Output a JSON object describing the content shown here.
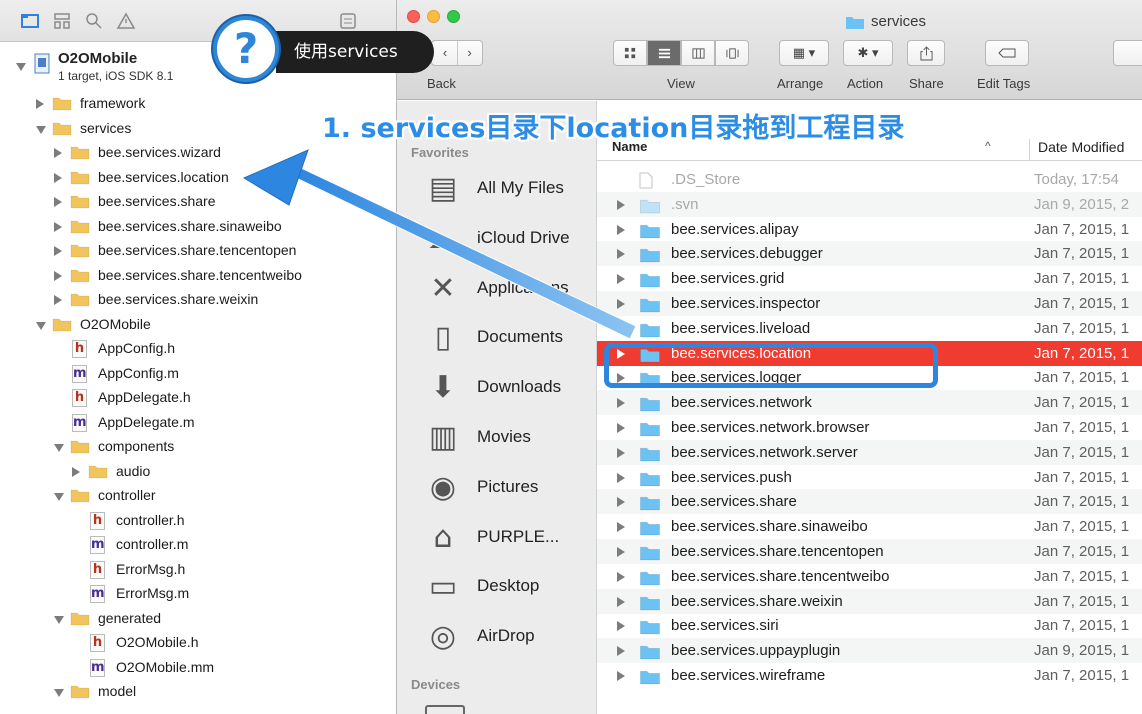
{
  "xcode": {
    "project": {
      "name": "O2OMobile",
      "subtitle": "1 target, iOS SDK 8.1"
    },
    "tree": [
      {
        "label": "framework",
        "kind": "folder",
        "indent": 1,
        "expanded": false,
        "disclosure": true
      },
      {
        "label": "services",
        "kind": "folder",
        "indent": 1,
        "expanded": true,
        "disclosure": true
      },
      {
        "label": "bee.services.wizard",
        "kind": "folder",
        "indent": 2,
        "expanded": false,
        "disclosure": true
      },
      {
        "label": "bee.services.location",
        "kind": "folder",
        "indent": 2,
        "expanded": false,
        "disclosure": true
      },
      {
        "label": "bee.services.share",
        "kind": "folder",
        "indent": 2,
        "expanded": false,
        "disclosure": true
      },
      {
        "label": "bee.services.share.sinaweibo",
        "kind": "folder",
        "indent": 2,
        "expanded": false,
        "disclosure": true
      },
      {
        "label": "bee.services.share.tencentopen",
        "kind": "folder",
        "indent": 2,
        "expanded": false,
        "disclosure": true
      },
      {
        "label": "bee.services.share.tencentweibo",
        "kind": "folder",
        "indent": 2,
        "expanded": false,
        "disclosure": true
      },
      {
        "label": "bee.services.share.weixin",
        "kind": "folder",
        "indent": 2,
        "expanded": false,
        "disclosure": true
      },
      {
        "label": "O2OMobile",
        "kind": "folder",
        "indent": 1,
        "expanded": true,
        "disclosure": true
      },
      {
        "label": "AppConfig.h",
        "kind": "h",
        "indent": 2,
        "disclosure": false
      },
      {
        "label": "AppConfig.m",
        "kind": "m",
        "indent": 2,
        "disclosure": false
      },
      {
        "label": "AppDelegate.h",
        "kind": "h",
        "indent": 2,
        "disclosure": false
      },
      {
        "label": "AppDelegate.m",
        "kind": "m",
        "indent": 2,
        "disclosure": false
      },
      {
        "label": "components",
        "kind": "folder",
        "indent": 2,
        "expanded": true,
        "disclosure": true
      },
      {
        "label": "audio",
        "kind": "folder",
        "indent": 3,
        "expanded": false,
        "disclosure": true
      },
      {
        "label": "controller",
        "kind": "folder",
        "indent": 2,
        "expanded": true,
        "disclosure": true
      },
      {
        "label": "controller.h",
        "kind": "h",
        "indent": 3,
        "disclosure": false
      },
      {
        "label": "controller.m",
        "kind": "m",
        "indent": 3,
        "disclosure": false
      },
      {
        "label": "ErrorMsg.h",
        "kind": "h",
        "indent": 3,
        "disclosure": false
      },
      {
        "label": "ErrorMsg.m",
        "kind": "m",
        "indent": 3,
        "disclosure": false
      },
      {
        "label": "generated",
        "kind": "folder",
        "indent": 2,
        "expanded": true,
        "disclosure": true
      },
      {
        "label": "O2OMobile.h",
        "kind": "h",
        "indent": 3,
        "disclosure": false
      },
      {
        "label": "O2OMobile.mm",
        "kind": "m",
        "indent": 3,
        "disclosure": false
      },
      {
        "label": "model",
        "kind": "folder",
        "indent": 2,
        "expanded": true,
        "disclosure": true
      }
    ]
  },
  "finder": {
    "title": "services",
    "toolbar": {
      "back_label": "Back",
      "view_label": "View",
      "arrange_label": "Arrange",
      "action_label": "Action",
      "share_label": "Share",
      "edit_tags_label": "Edit Tags"
    },
    "sidebar": {
      "favorites_heading": "Favorites",
      "devices_heading": "Devices",
      "items": [
        {
          "label": "All My Files",
          "icon": "all-files-icon",
          "glyph": "▤"
        },
        {
          "label": "iCloud Drive",
          "icon": "cloud-icon",
          "glyph": "☁"
        },
        {
          "label": "Applications",
          "icon": "applications-icon",
          "glyph": "✕"
        },
        {
          "label": "Documents",
          "icon": "documents-icon",
          "glyph": "▯"
        },
        {
          "label": "Downloads",
          "icon": "downloads-icon",
          "glyph": "⬇"
        },
        {
          "label": "Movies",
          "icon": "movies-icon",
          "glyph": "▥"
        },
        {
          "label": "Pictures",
          "icon": "pictures-icon",
          "glyph": "◉"
        },
        {
          "label": "PURPLE...",
          "icon": "home-icon",
          "glyph": "⌂"
        },
        {
          "label": "Desktop",
          "icon": "desktop-icon",
          "glyph": "▭"
        },
        {
          "label": "AirDrop",
          "icon": "airdrop-icon",
          "glyph": "◎"
        }
      ]
    },
    "columns": {
      "name": "Name",
      "sort_indicator": "^",
      "date": "Date Modified"
    },
    "files": [
      {
        "name": ".DS_Store",
        "date": "Today, 17:54",
        "folder": false,
        "dim": true
      },
      {
        "name": ".svn",
        "date": "Jan 9, 2015, 2",
        "folder": true,
        "dim": true
      },
      {
        "name": "bee.services.alipay",
        "date": "Jan 7, 2015, 1",
        "folder": true
      },
      {
        "name": "bee.services.debugger",
        "date": "Jan 7, 2015, 1",
        "folder": true
      },
      {
        "name": "bee.services.grid",
        "date": "Jan 7, 2015, 1",
        "folder": true
      },
      {
        "name": "bee.services.inspector",
        "date": "Jan 7, 2015, 1",
        "folder": true
      },
      {
        "name": "bee.services.liveload",
        "date": "Jan 7, 2015, 1",
        "folder": true
      },
      {
        "name": "bee.services.location",
        "date": "Jan 7, 2015, 1",
        "folder": true,
        "selected": true
      },
      {
        "name": "bee.services.logger",
        "date": "Jan 7, 2015, 1",
        "folder": true
      },
      {
        "name": "bee.services.network",
        "date": "Jan 7, 2015, 1",
        "folder": true
      },
      {
        "name": "bee.services.network.browser",
        "date": "Jan 7, 2015, 1",
        "folder": true
      },
      {
        "name": "bee.services.network.server",
        "date": "Jan 7, 2015, 1",
        "folder": true
      },
      {
        "name": "bee.services.push",
        "date": "Jan 7, 2015, 1",
        "folder": true
      },
      {
        "name": "bee.services.share",
        "date": "Jan 7, 2015, 1",
        "folder": true
      },
      {
        "name": "bee.services.share.sinaweibo",
        "date": "Jan 7, 2015, 1",
        "folder": true
      },
      {
        "name": "bee.services.share.tencentopen",
        "date": "Jan 7, 2015, 1",
        "folder": true
      },
      {
        "name": "bee.services.share.tencentweibo",
        "date": "Jan 7, 2015, 1",
        "folder": true
      },
      {
        "name": "bee.services.share.weixin",
        "date": "Jan 7, 2015, 1",
        "folder": true
      },
      {
        "name": "bee.services.siri",
        "date": "Jan 7, 2015, 1",
        "folder": true
      },
      {
        "name": "bee.services.uppayplugin",
        "date": "Jan 9, 2015, 1",
        "folder": true
      },
      {
        "name": "bee.services.wireframe",
        "date": "Jan 7, 2015, 1",
        "folder": true
      }
    ]
  },
  "annotation": {
    "help_mark": "?",
    "help_label": "使用services",
    "instruction": "1. services目录下location目录拖到工程目录",
    "arrow_color": "#2d86e0"
  },
  "colors": {
    "folder_yellow": "#f2c55c",
    "folder_blue": "#6cc3f3",
    "selection_red": "#ef3b30",
    "annotation_blue": "#2d86e0"
  }
}
